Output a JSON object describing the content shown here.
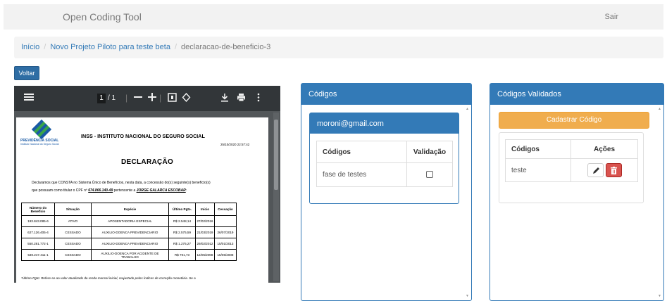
{
  "app": {
    "brand": "Open Coding Tool",
    "logout": "Sair"
  },
  "breadcrumb": [
    "Início",
    "Novo Projeto Piloto para teste beta",
    "declaracao-de-beneficio-3"
  ],
  "back_button": "Voltar",
  "pdf": {
    "page_current": "1",
    "page_total": "/ 1",
    "doc": {
      "logo_title": "PREVIDÊNCIA SOCIAL",
      "logo_subtitle": "Instituto Nacional do Seguro Social",
      "header": "INSS - INSTITUTO NACIONAL DO SEGURO SOCIAL",
      "timestamp": "25/10/2020 22:57:42",
      "title": "DECLARAÇÃO",
      "para_line1": "Declaramos que CONSTA no Sistema Único de Benefícios, nesta data, a concessão do(s) seguinte(s) benefício(s)",
      "para_line2_pre": "que possuam como titular o CPF nº",
      "cpf": "674.866.140-49",
      "para_line2_mid": "pertencente a",
      "name": "JORGE GALARCA ESCOBAR",
      "columns": [
        "Número do Benefício",
        "Situação",
        "Espécie",
        "Último Pgto.",
        "Início",
        "Cessação"
      ],
      "rows": [
        [
          "193.843.085-6",
          "ATIVO",
          "APOSENTADORIA ESPECIAL",
          "R$ 2.548,14",
          "27/02/2016",
          ""
        ],
        [
          "627.126.405-4",
          "CESSADO",
          "AUXILIO-DOENCA PREVIDENCIARIO",
          "R$ 2.575,59",
          "21/03/2019",
          "26/07/2019"
        ],
        [
          "550.281.772-1",
          "CESSADO",
          "AUXILIO-DOENCA PREVIDENCIARIO",
          "R$ 1.275,27",
          "29/02/2012",
          "15/01/2013"
        ],
        [
          "530.247.411-1",
          "CESSADO",
          "AUXILIO-DOENCA POR ACIDENTE DE TRABALHO",
          "R$ 701,73",
          "12/05/2008",
          "15/06/2008"
        ]
      ],
      "footnote": "*Último Pgto: Refere-se ao valor atualizado da renda mensal inicial, reajustado pelos índices de correção monetária. Se a"
    }
  },
  "codes_panel": {
    "title": "Códigos",
    "user": "moroni@gmail.com",
    "col_codes": "Códigos",
    "col_validation": "Validação",
    "rows": [
      {
        "code": "fase de testes",
        "validated": false
      }
    ]
  },
  "validated_panel": {
    "title": "Códigos Validados",
    "add_button": "Cadastrar Código",
    "col_codes": "Códigos",
    "col_actions": "Ações",
    "rows": [
      {
        "code": "teste"
      }
    ]
  },
  "colors": {
    "primary": "#337ab7",
    "warning": "#f0ad4e",
    "danger": "#d9534f",
    "pdf_toolbar": "#323639"
  }
}
